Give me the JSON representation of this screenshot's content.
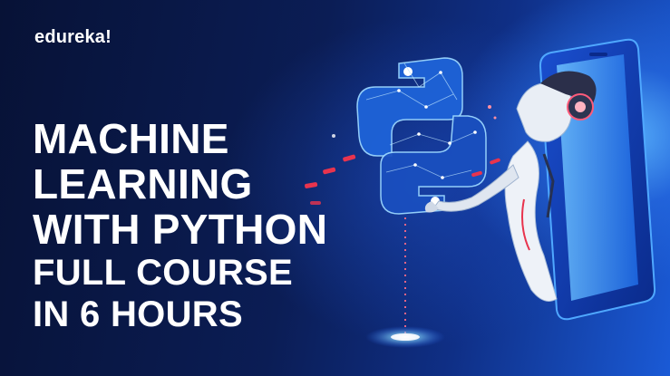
{
  "brand": {
    "logo_text": "edureka!"
  },
  "title": {
    "lines": [
      "MACHINE",
      "LEARNING",
      "WITH PYTHON",
      "FULL COURSE",
      "IN 6 HOURS"
    ]
  },
  "illustration": {
    "icons": [
      "python-logo-icon",
      "robot-woman-icon",
      "smartphone-icon"
    ],
    "colors": {
      "glow": "#5fb4ff",
      "accent": "#e8344e",
      "text": "#ffffff"
    }
  }
}
